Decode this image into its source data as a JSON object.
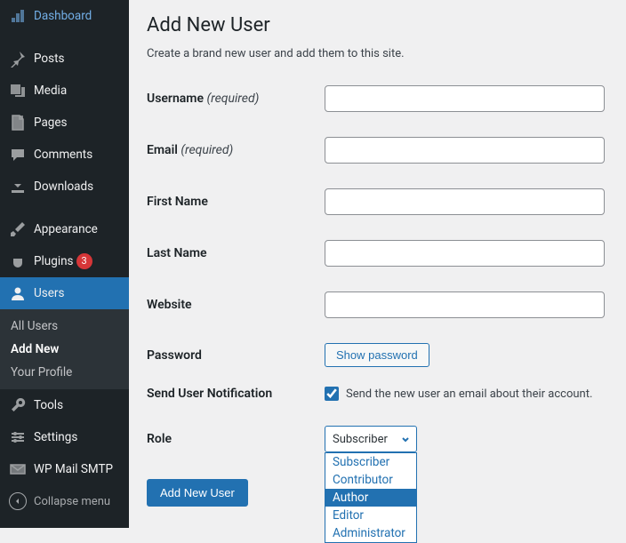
{
  "sidebar": {
    "items": [
      {
        "label": "Dashboard"
      },
      {
        "label": "Posts"
      },
      {
        "label": "Media"
      },
      {
        "label": "Pages"
      },
      {
        "label": "Comments"
      },
      {
        "label": "Downloads"
      },
      {
        "label": "Appearance"
      },
      {
        "label": "Plugins",
        "badge": "3"
      },
      {
        "label": "Users"
      },
      {
        "label": "Tools"
      },
      {
        "label": "Settings"
      },
      {
        "label": "WP Mail SMTP"
      }
    ],
    "submenu": [
      {
        "label": "All Users"
      },
      {
        "label": "Add New"
      },
      {
        "label": "Your Profile"
      }
    ],
    "collapse": "Collapse menu"
  },
  "page": {
    "title": "Add New User",
    "description": "Create a brand new user and add them to this site.",
    "form": {
      "username_label": "Username",
      "username_req": "(required)",
      "email_label": "Email",
      "email_req": "(required)",
      "firstname_label": "First Name",
      "lastname_label": "Last Name",
      "website_label": "Website",
      "password_label": "Password",
      "show_password_button": "Show password",
      "notification_label": "Send User Notification",
      "notification_text": "Send the new user an email about their account.",
      "notification_checked": true,
      "role_label": "Role",
      "role_selected": "Subscriber",
      "role_options": [
        "Subscriber",
        "Contributor",
        "Author",
        "Editor",
        "Administrator"
      ],
      "role_highlighted_index": 2,
      "submit": "Add New User"
    }
  }
}
